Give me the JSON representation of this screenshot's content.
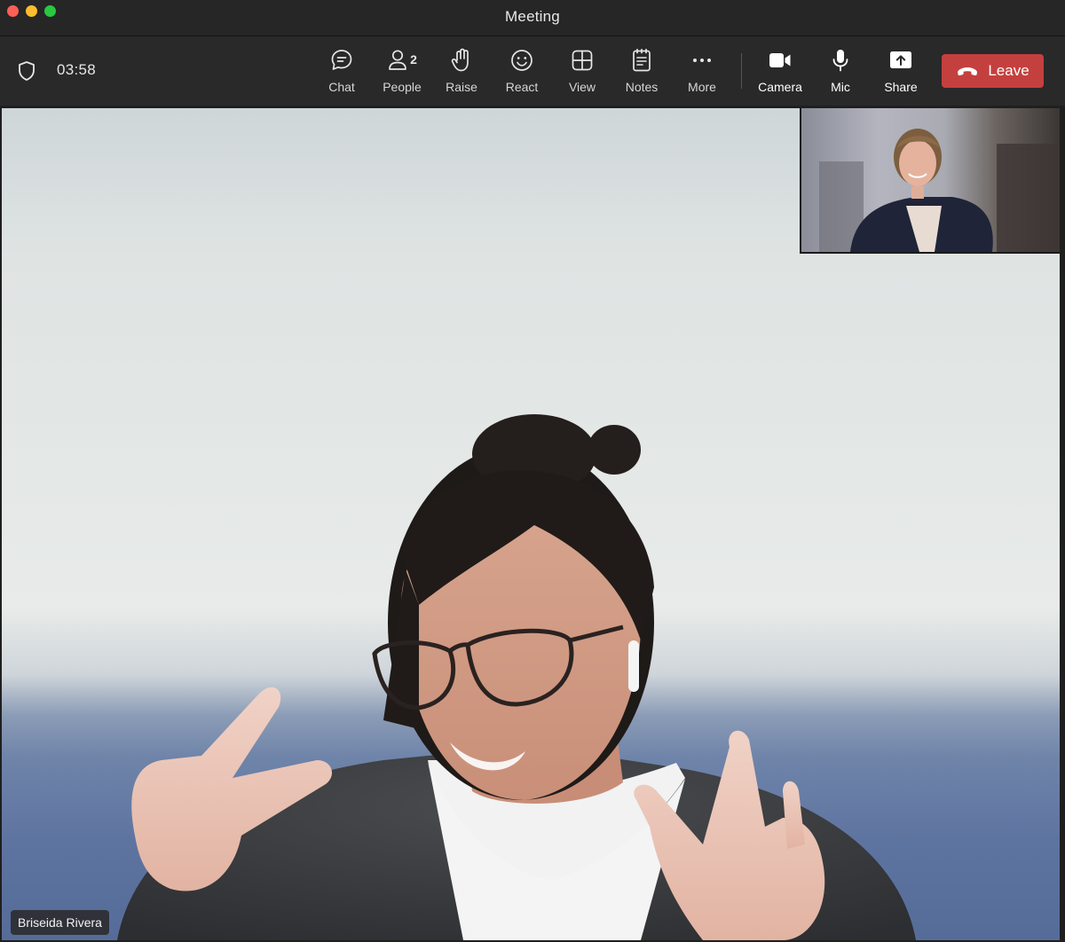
{
  "window": {
    "title": "Meeting"
  },
  "toolbar": {
    "timer": "03:58",
    "buttons": {
      "chat": "Chat",
      "people": "People",
      "people_count": "2",
      "raise": "Raise",
      "react": "React",
      "view": "View",
      "notes": "Notes",
      "more": "More",
      "camera": "Camera",
      "mic": "Mic",
      "share": "Share"
    },
    "leave_label": "Leave",
    "leave_color": "#c4403f"
  },
  "stage": {
    "main_participant": "Briseida Rivera"
  }
}
